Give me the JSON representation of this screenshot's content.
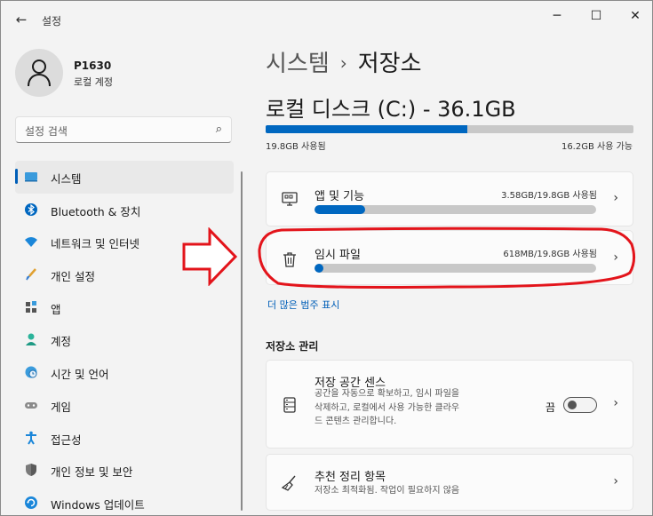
{
  "window": {
    "app_title": "설정",
    "back_icon": "back-arrow-icon",
    "controls": [
      "minimize-icon",
      "maximize-icon",
      "close-icon"
    ]
  },
  "user": {
    "name": "P1630",
    "account_type": "로컬 계정"
  },
  "search": {
    "placeholder": "설정 검색",
    "icon": "search-icon"
  },
  "sidebar": {
    "items": [
      {
        "label": "시스템",
        "icon": "monitor-icon",
        "active": true
      },
      {
        "label": "Bluetooth & 장치",
        "icon": "bluetooth-icon",
        "active": false
      },
      {
        "label": "네트워크 및 인터넷",
        "icon": "wifi-icon",
        "active": false
      },
      {
        "label": "개인 설정",
        "icon": "brush-icon",
        "active": false
      },
      {
        "label": "앱",
        "icon": "apps-icon",
        "active": false
      },
      {
        "label": "계정",
        "icon": "person-icon",
        "active": false
      },
      {
        "label": "시간 및 언어",
        "icon": "clock-globe-icon",
        "active": false
      },
      {
        "label": "게임",
        "icon": "gamepad-icon",
        "active": false
      },
      {
        "label": "접근성",
        "icon": "accessibility-icon",
        "active": false
      },
      {
        "label": "개인 정보 및 보안",
        "icon": "shield-icon",
        "active": false
      },
      {
        "label": "Windows 업데이트",
        "icon": "update-icon",
        "active": false
      }
    ]
  },
  "breadcrumb": {
    "parent": "시스템",
    "separator": "›",
    "current": "저장소"
  },
  "disk": {
    "title": "로컬 디스크 (C:) - 36.1GB",
    "used_label": "19.8GB 사용됨",
    "free_label": "16.2GB 사용 가능",
    "used_fraction": 0.548
  },
  "categories": [
    {
      "title": "앱 및 기능",
      "size": "3.58GB/19.8GB 사용됨",
      "icon": "apps-features-icon",
      "fill_fraction": 0.18
    },
    {
      "title": "임시 파일",
      "size": "618MB/19.8GB 사용됨",
      "icon": "trash-icon",
      "fill_fraction": 0.03
    }
  ],
  "more_link": "더 많은 범주 표시",
  "management": {
    "heading": "저장소 관리",
    "sense": {
      "title": "저장 공간 센스",
      "description": "공간을 자동으로 확보하고, 임시 파일을 삭제하고, 로컬에서 사용 가능한 클라우드 콘텐츠 관리합니다.",
      "toggle_label": "끔",
      "icon": "storage-drive-icon",
      "toggle_on": false
    },
    "recommendations": {
      "title": "추천 정리 항목",
      "description": "저장소 최적화됨. 작업이 필요하지 않음",
      "icon": "broom-icon"
    }
  },
  "annotations": {
    "arrow_icon": "red-arrow-icon",
    "highlight": "red-ellipse-highlight",
    "color": "#e3141b"
  },
  "colors": {
    "accent": "#0067c0",
    "link": "#005fb8",
    "bar_track": "#c8c8c8"
  }
}
